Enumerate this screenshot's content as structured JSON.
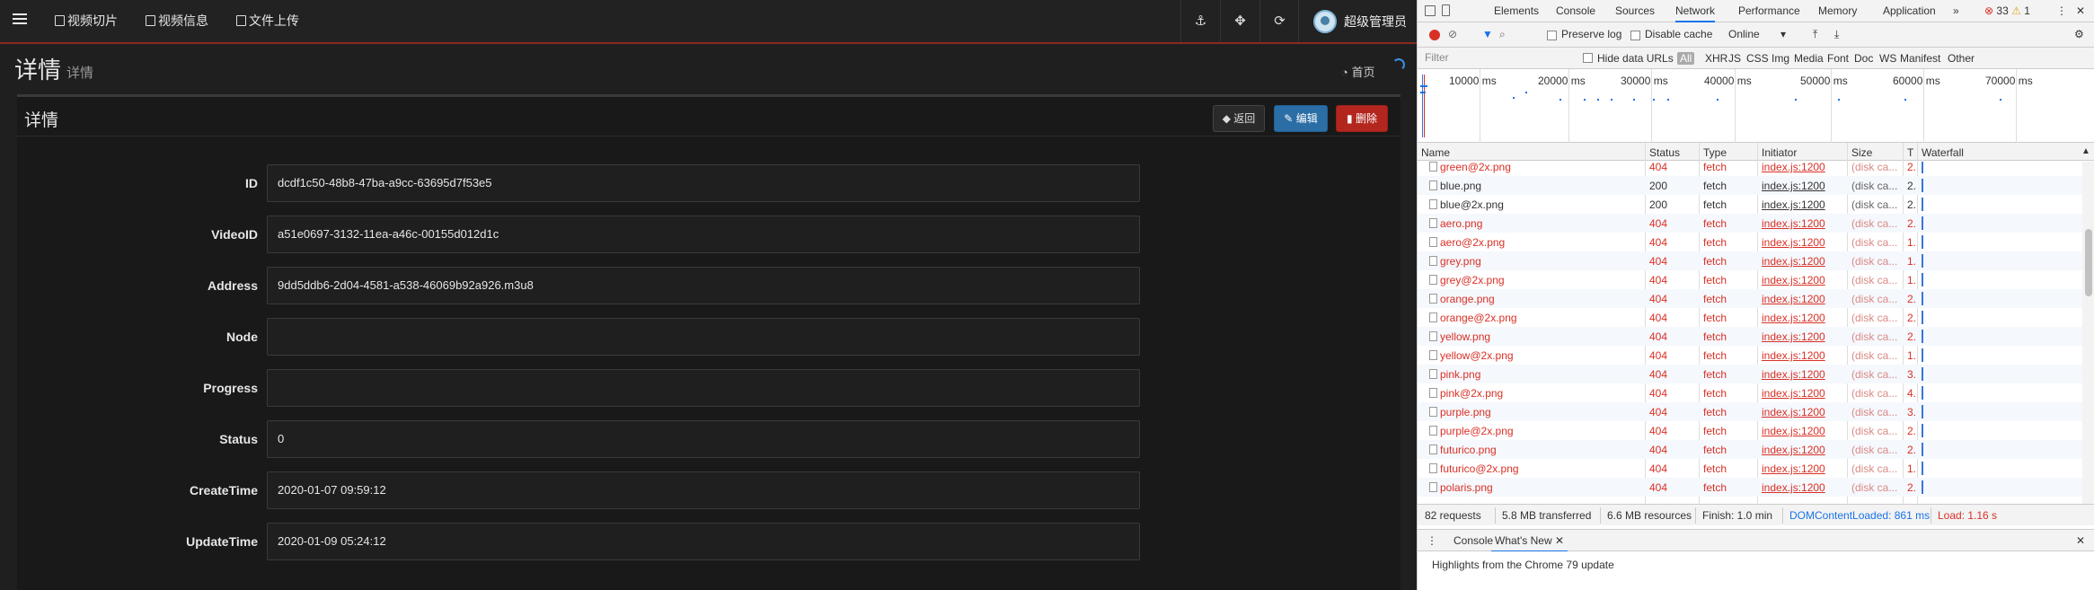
{
  "navbar": {
    "links": [
      "视频切片",
      "视频信息",
      "文件上传"
    ],
    "tools": [
      "⚓",
      "✥",
      "⟳"
    ],
    "user": "超级管理员"
  },
  "header": {
    "title": "详情",
    "subtitle": "详情",
    "home": "首页"
  },
  "panel": {
    "title": "详情",
    "back": "返回",
    "edit": "编辑",
    "delete": "删除",
    "fields": [
      {
        "label": "ID",
        "value": "dcdf1c50-48b8-47ba-a9cc-63695d7f53e5"
      },
      {
        "label": "VideoID",
        "value": "a51e0697-3132-11ea-a46c-00155d012d1c"
      },
      {
        "label": "Address",
        "value": "9dd5ddb6-2d04-4581-a538-46069b92a926.m3u8"
      },
      {
        "label": "Node",
        "value": ""
      },
      {
        "label": "Progress",
        "value": ""
      },
      {
        "label": "Status",
        "value": "0"
      },
      {
        "label": "CreateTime",
        "value": "2020-01-07 09:59:12"
      },
      {
        "label": "UpdateTime",
        "value": "2020-01-09 05:24:12"
      }
    ]
  },
  "devtools": {
    "tabs": [
      "Elements",
      "Console",
      "Sources",
      "Network",
      "Performance",
      "Memory",
      "Application"
    ],
    "active_tab": "Network",
    "more": "»",
    "errors": "33",
    "warnings": "1",
    "toolbar": {
      "preserve_log": "Preserve log",
      "disable_cache": "Disable cache",
      "throttle": "Online"
    },
    "filter": {
      "placeholder": "Filter",
      "hide_data_urls": "Hide data URLs",
      "types": [
        "All",
        "XHR",
        "JS",
        "CSS",
        "Img",
        "Media",
        "Font",
        "Doc",
        "WS",
        "Manifest",
        "Other"
      ]
    },
    "overview_labels": [
      "10000 ms",
      "20000 ms",
      "30000 ms",
      "40000 ms",
      "50000 ms",
      "60000 ms",
      "70000 ms"
    ],
    "columns": [
      "Name",
      "Status",
      "Type",
      "Initiator",
      "Size",
      "T",
      "Waterfall"
    ],
    "rows": [
      {
        "name": "green@2x.png",
        "status": "404",
        "type": "fetch",
        "initiator": "index.js:1200",
        "size": "(disk ca...",
        "time": "2.",
        "error": true
      },
      {
        "name": "blue.png",
        "status": "200",
        "type": "fetch",
        "initiator": "index.js:1200",
        "size": "(disk ca...",
        "time": "2.",
        "error": false
      },
      {
        "name": "blue@2x.png",
        "status": "200",
        "type": "fetch",
        "initiator": "index.js:1200",
        "size": "(disk ca...",
        "time": "2.",
        "error": false
      },
      {
        "name": "aero.png",
        "status": "404",
        "type": "fetch",
        "initiator": "index.js:1200",
        "size": "(disk ca...",
        "time": "2.",
        "error": true
      },
      {
        "name": "aero@2x.png",
        "status": "404",
        "type": "fetch",
        "initiator": "index.js:1200",
        "size": "(disk ca...",
        "time": "1.",
        "error": true
      },
      {
        "name": "grey.png",
        "status": "404",
        "type": "fetch",
        "initiator": "index.js:1200",
        "size": "(disk ca...",
        "time": "1.",
        "error": true
      },
      {
        "name": "grey@2x.png",
        "status": "404",
        "type": "fetch",
        "initiator": "index.js:1200",
        "size": "(disk ca...",
        "time": "1.",
        "error": true
      },
      {
        "name": "orange.png",
        "status": "404",
        "type": "fetch",
        "initiator": "index.js:1200",
        "size": "(disk ca...",
        "time": "2.",
        "error": true
      },
      {
        "name": "orange@2x.png",
        "status": "404",
        "type": "fetch",
        "initiator": "index.js:1200",
        "size": "(disk ca...",
        "time": "2.",
        "error": true
      },
      {
        "name": "yellow.png",
        "status": "404",
        "type": "fetch",
        "initiator": "index.js:1200",
        "size": "(disk ca...",
        "time": "2.",
        "error": true
      },
      {
        "name": "yellow@2x.png",
        "status": "404",
        "type": "fetch",
        "initiator": "index.js:1200",
        "size": "(disk ca...",
        "time": "1.",
        "error": true
      },
      {
        "name": "pink.png",
        "status": "404",
        "type": "fetch",
        "initiator": "index.js:1200",
        "size": "(disk ca...",
        "time": "3.",
        "error": true
      },
      {
        "name": "pink@2x.png",
        "status": "404",
        "type": "fetch",
        "initiator": "index.js:1200",
        "size": "(disk ca...",
        "time": "4.",
        "error": true
      },
      {
        "name": "purple.png",
        "status": "404",
        "type": "fetch",
        "initiator": "index.js:1200",
        "size": "(disk ca...",
        "time": "3.",
        "error": true
      },
      {
        "name": "purple@2x.png",
        "status": "404",
        "type": "fetch",
        "initiator": "index.js:1200",
        "size": "(disk ca...",
        "time": "2.",
        "error": true
      },
      {
        "name": "futurico.png",
        "status": "404",
        "type": "fetch",
        "initiator": "index.js:1200",
        "size": "(disk ca...",
        "time": "2.",
        "error": true
      },
      {
        "name": "futurico@2x.png",
        "status": "404",
        "type": "fetch",
        "initiator": "index.js:1200",
        "size": "(disk ca...",
        "time": "1.",
        "error": true
      },
      {
        "name": "polaris.png",
        "status": "404",
        "type": "fetch",
        "initiator": "index.js:1200",
        "size": "(disk ca...",
        "time": "2.",
        "error": true
      }
    ],
    "status_bar": {
      "requests": "82 requests",
      "transferred": "5.8 MB transferred",
      "resources": "6.6 MB resources",
      "finish": "Finish: 1.0 min",
      "dcl": "DOMContentLoaded: 861 ms",
      "load": "Load: 1.16 s"
    },
    "drawer": {
      "tabs": [
        "Console",
        "What's New"
      ],
      "whats_new": "Highlights from the Chrome 79 update"
    }
  }
}
